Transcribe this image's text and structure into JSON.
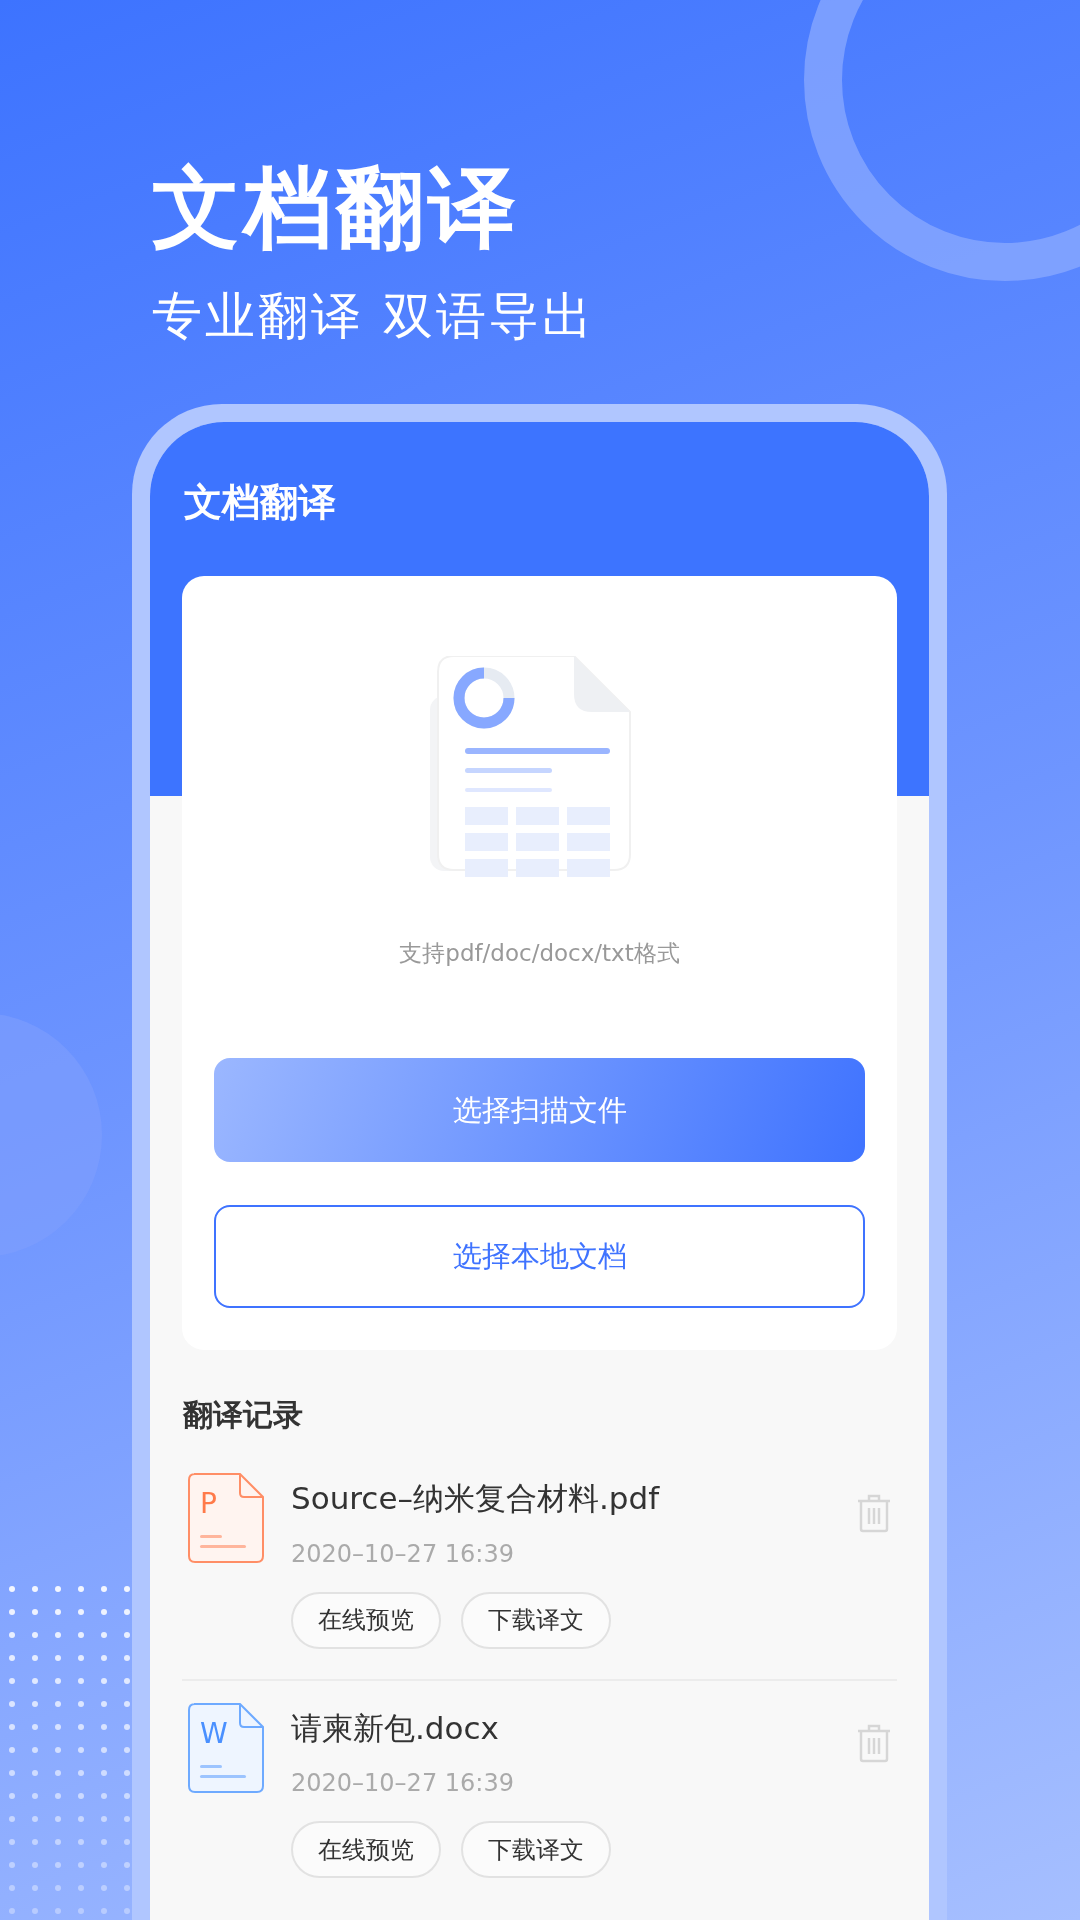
{
  "promo": {
    "title": "文档翻译",
    "subtitle": "专业翻译 双语导出"
  },
  "app": {
    "title": "文档翻译",
    "support_text": "支持pdf/doc/docx/txt格式",
    "buttons": [
      {
        "label": "选择扫描文件",
        "kind": "primary"
      },
      {
        "label": "选择本地文档",
        "kind": "outline"
      }
    ],
    "records_title": "翻译记录",
    "records": [
      {
        "badge": "P",
        "kind": "pdf",
        "name": "Source–纳米复合材料.pdf",
        "time": "2020–10–27 16:39",
        "actions": [
          "在线预览",
          "下载译文"
        ]
      },
      {
        "badge": "W",
        "kind": "word",
        "name": "请柬新包.docx",
        "time": "2020–10–27 16:39",
        "actions": [
          "在线预览",
          "下载译文"
        ]
      }
    ]
  }
}
